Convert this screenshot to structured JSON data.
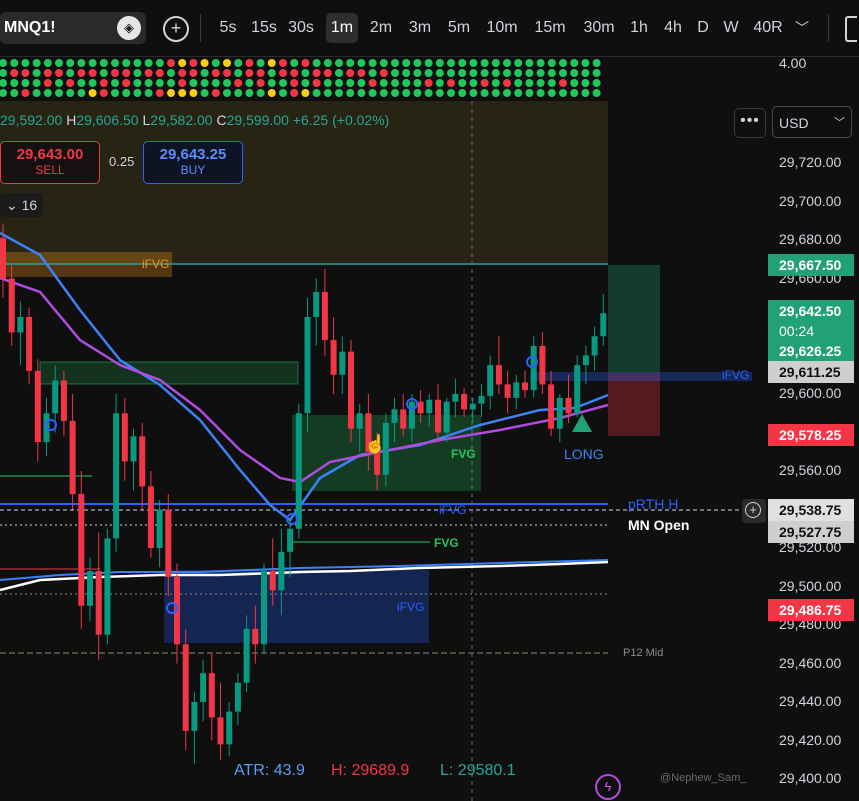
{
  "toolbar": {
    "symbol": "MNQ1!",
    "timeframes": [
      "5s",
      "15s",
      "30s",
      "1m",
      "2m",
      "3m",
      "5m",
      "10m",
      "15m",
      "30m",
      "1h",
      "4h",
      "D",
      "W",
      "40R"
    ],
    "active_timeframe": "1m"
  },
  "legend": {
    "o_label": "O",
    "o_value": "29,592.00",
    "h_label": "H",
    "h_value": "29,606.50",
    "l_label": "L",
    "l_value": "29,582.00",
    "c_label": "C",
    "c_value": "29,599.00",
    "change": "+6.25 (+0.02%)"
  },
  "order_panel": {
    "sell_price": "29,643.00",
    "sell_label": "SELL",
    "spread": "0.25",
    "buy_price": "29,643.25",
    "buy_label": "BUY",
    "quantity": "16"
  },
  "currency": "USD",
  "price_axis": {
    "top_value": "4.00",
    "labels": [
      "29,720.00",
      "29,700.00",
      "29,680.00",
      "29,660.00",
      "29,640.00",
      "29,620.00",
      "29,600.00",
      "29,580.00",
      "29,560.00",
      "29,540.00",
      "29,520.00",
      "29,500.00",
      "29,480.00",
      "29,460.00",
      "29,440.00",
      "29,420.00",
      "29,400.00"
    ]
  },
  "price_tags": {
    "tp": "29,667.50",
    "last_price": "29,642.50",
    "countdown": "00:24",
    "level_a": "29,626.25",
    "level_b": "29,611.25",
    "stop": "29,578.25",
    "prth_h": "29,538.75",
    "mn_open": "29,527.75",
    "level_c": "29,486.75"
  },
  "chart_labels": {
    "ifvg_top": "iFVG",
    "ifvg_right": "iFVG",
    "fvg_mid": "FVG",
    "ifvg_blue_line": "iFVG",
    "fvg_low": "FVG",
    "ifvg_box": "iFVG",
    "prth": "pRTH H",
    "mn_open": "MN Open",
    "long": "LONG",
    "p12": "P12 Mid"
  },
  "stats": {
    "atr": "ATR: 43.9",
    "high": "H: 29689.9",
    "low": "L: 29580.1"
  },
  "watermark": "@Nephew_Sam_",
  "colors": {
    "up": "#089981",
    "down": "#f23645",
    "accent_blue": "#2962ff",
    "tag_green": "#22a174"
  },
  "chart_data": {
    "type": "candlestick",
    "price_range": [
      29395,
      29745
    ],
    "candles": [
      [
        29681,
        29688,
        29650,
        29660
      ],
      [
        29660,
        29667,
        29625,
        29632
      ],
      [
        29632,
        29648,
        29615,
        29640
      ],
      [
        29640,
        29645,
        29605,
        29612
      ],
      [
        29612,
        29618,
        29565,
        29575
      ],
      [
        29575,
        29598,
        29568,
        29590
      ],
      [
        29590,
        29615,
        29580,
        29607
      ],
      [
        29607,
        29612,
        29578,
        29586
      ],
      [
        29586,
        29600,
        29540,
        29548
      ],
      [
        29548,
        29560,
        29478,
        29490
      ],
      [
        29490,
        29515,
        29482,
        29508
      ],
      [
        29508,
        29528,
        29462,
        29475
      ],
      [
        29475,
        29530,
        29470,
        29525
      ],
      [
        29525,
        29600,
        29518,
        29590
      ],
      [
        29590,
        29598,
        29555,
        29565
      ],
      [
        29565,
        29582,
        29550,
        29578
      ],
      [
        29578,
        29585,
        29540,
        29552
      ],
      [
        29552,
        29560,
        29515,
        29520
      ],
      [
        29520,
        29545,
        29510,
        29540
      ],
      [
        29540,
        29548,
        29495,
        29505
      ],
      [
        29505,
        29512,
        29460,
        29470
      ],
      [
        29470,
        29478,
        29415,
        29425
      ],
      [
        29425,
        29445,
        29408,
        29440
      ],
      [
        29440,
        29462,
        29430,
        29455
      ],
      [
        29455,
        29465,
        29420,
        29432
      ],
      [
        29432,
        29450,
        29410,
        29418
      ],
      [
        29418,
        29440,
        29412,
        29435
      ],
      [
        29435,
        29455,
        29428,
        29450
      ],
      [
        29450,
        29485,
        29445,
        29478
      ],
      [
        29478,
        29490,
        29460,
        29470
      ],
      [
        29470,
        29512,
        29465,
        29508
      ],
      [
        29508,
        29525,
        29490,
        29498
      ],
      [
        29498,
        29530,
        29485,
        29518
      ],
      [
        29518,
        29535,
        29505,
        29530
      ],
      [
        29530,
        29595,
        29525,
        29590
      ],
      [
        29590,
        29650,
        29580,
        29640
      ],
      [
        29640,
        29660,
        29625,
        29653
      ],
      [
        29653,
        29665,
        29620,
        29628
      ],
      [
        29628,
        29640,
        29600,
        29610
      ],
      [
        29610,
        29630,
        29600,
        29622
      ],
      [
        29622,
        29628,
        29575,
        29582
      ],
      [
        29582,
        29595,
        29570,
        29590
      ],
      [
        29590,
        29600,
        29560,
        29570
      ],
      [
        29570,
        29580,
        29550,
        29558
      ],
      [
        29558,
        29590,
        29552,
        29585
      ],
      [
        29585,
        29598,
        29575,
        29592
      ],
      [
        29592,
        29600,
        29578,
        29582
      ],
      [
        29582,
        29600,
        29575,
        29596
      ],
      [
        29596,
        29602,
        29585,
        29590
      ],
      [
        29590,
        29600,
        29583,
        29597
      ],
      [
        29597,
        29605,
        29575,
        29580
      ],
      [
        29580,
        29598,
        29575,
        29596
      ],
      [
        29596,
        29608,
        29588,
        29600
      ],
      [
        29600,
        29603,
        29588,
        29592
      ],
      [
        29592,
        29598,
        29585,
        29595
      ],
      [
        29595,
        29605,
        29588,
        29599
      ],
      [
        29599,
        29620,
        29592,
        29615
      ],
      [
        29615,
        29630,
        29600,
        29605
      ],
      [
        29605,
        29612,
        29590,
        29598
      ],
      [
        29598,
        29610,
        29592,
        29606
      ],
      [
        29606,
        29612,
        29598,
        29602
      ],
      [
        29602,
        29630,
        29598,
        29625
      ],
      [
        29625,
        29632,
        29600,
        29605
      ],
      [
        29605,
        29612,
        29578,
        29582
      ],
      [
        29582,
        29600,
        29575,
        29598
      ],
      [
        29598,
        29610,
        29585,
        29590
      ],
      [
        29590,
        29620,
        29588,
        29615
      ],
      [
        29615,
        29625,
        29605,
        29620
      ],
      [
        29620,
        29635,
        29612,
        29630
      ],
      [
        29630,
        29652,
        29625,
        29642
      ]
    ]
  }
}
